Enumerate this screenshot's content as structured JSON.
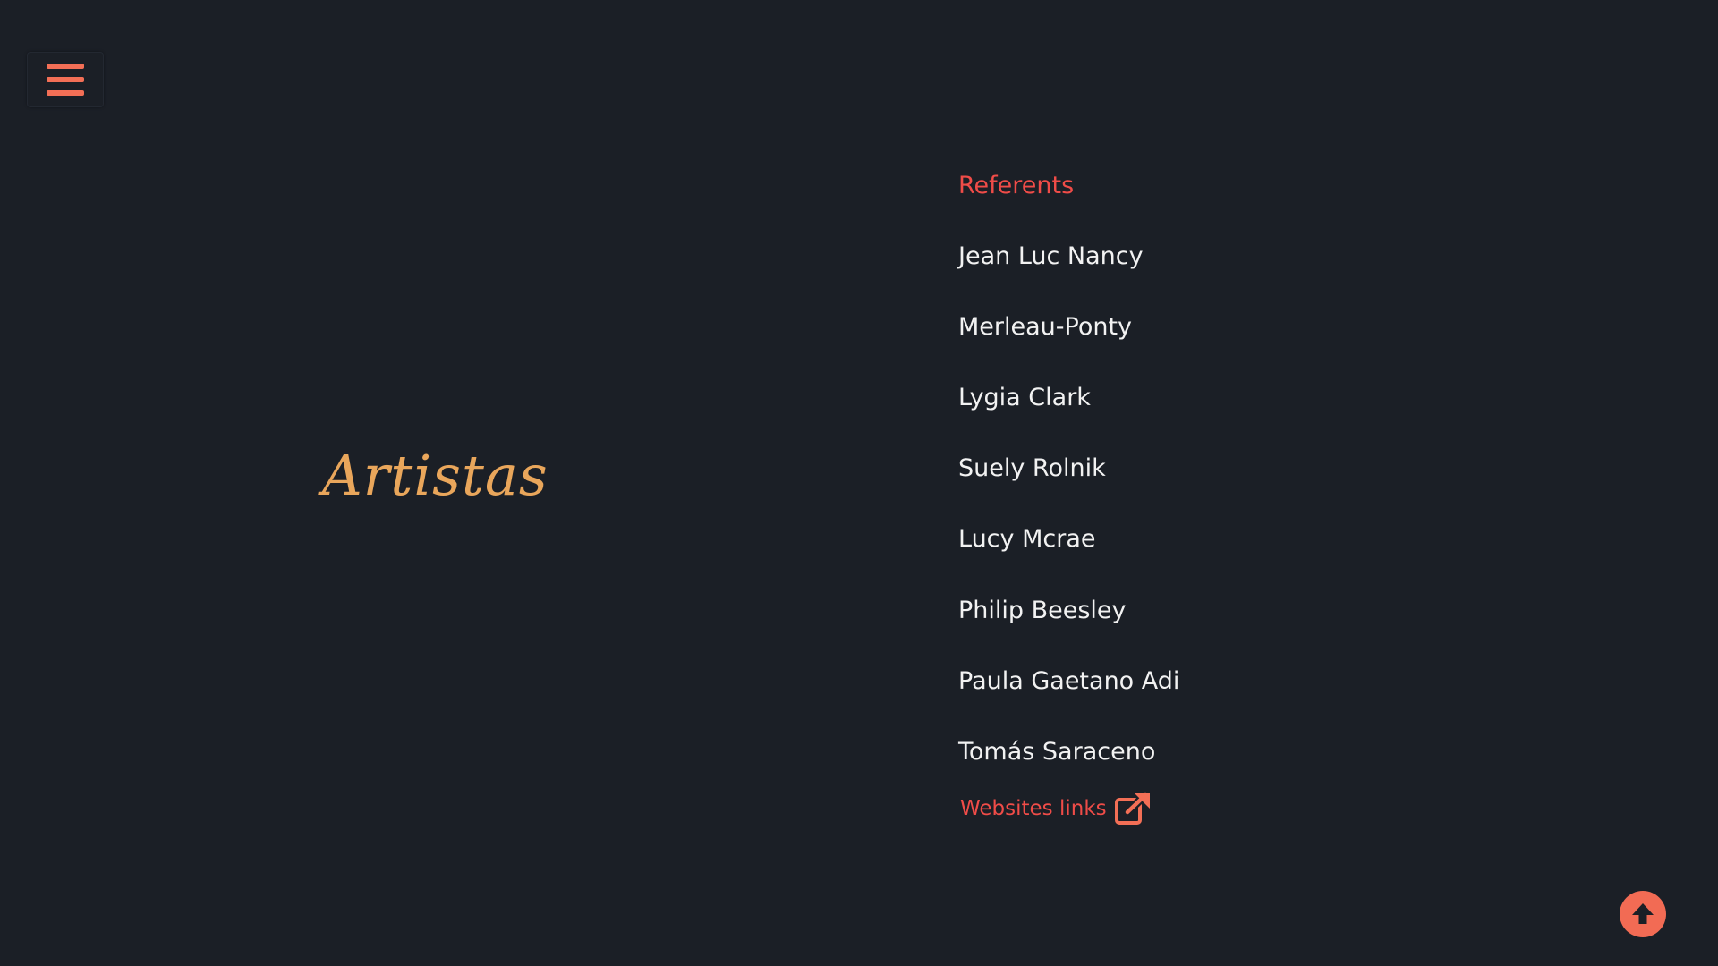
{
  "menu": {
    "icon": "hamburger-menu-icon"
  },
  "artists": {
    "title": "Artistas"
  },
  "referents": {
    "heading": "Referents",
    "items": [
      "Jean Luc Nancy",
      "Merleau-Ponty",
      "Lygia Clark",
      "Suely Rolnik",
      "Lucy Mcrae",
      "Philip Beesley",
      "Paula Gaetano Adi",
      "Tomás Saraceno"
    ],
    "link_label": "Websites links",
    "link_icon": "external-link-icon"
  },
  "scroll_top": {
    "icon": "arrow-up-circle-icon"
  },
  "colors": {
    "background": "#1b1f26",
    "accent": "#f36f56",
    "heading_red": "#f04c48",
    "title_gold": "#e9a65b",
    "text": "#f2f2f2"
  }
}
